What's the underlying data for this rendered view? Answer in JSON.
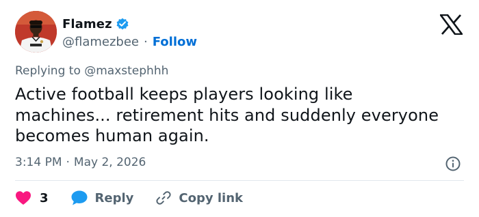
{
  "author": {
    "display_name": "Flamez",
    "handle": "@flamezbee",
    "separator": "·",
    "follow_label": "Follow",
    "verified_color": "#1d9bf0"
  },
  "reply_context": "Replying to @maxstephhh",
  "tweet": {
    "text": "Active football keeps players looking like\nmachines... retirement hits and suddenly everyone\nbecomes human again.",
    "time": "3:14 PM",
    "separator": "·",
    "date": "May 2, 2026"
  },
  "actions": {
    "like_count": "3",
    "reply_label": "Reply",
    "copy_link_label": "Copy link"
  },
  "colors": {
    "like": "#f91880",
    "reply": "#1d9bf0",
    "link": "#006fd6",
    "muted": "#536471"
  },
  "icons": {
    "logo": "x-logo-icon",
    "verified": "verified-badge-icon",
    "info": "info-icon",
    "like": "heart-icon",
    "reply": "reply-bubble-icon",
    "copy": "link-icon"
  }
}
